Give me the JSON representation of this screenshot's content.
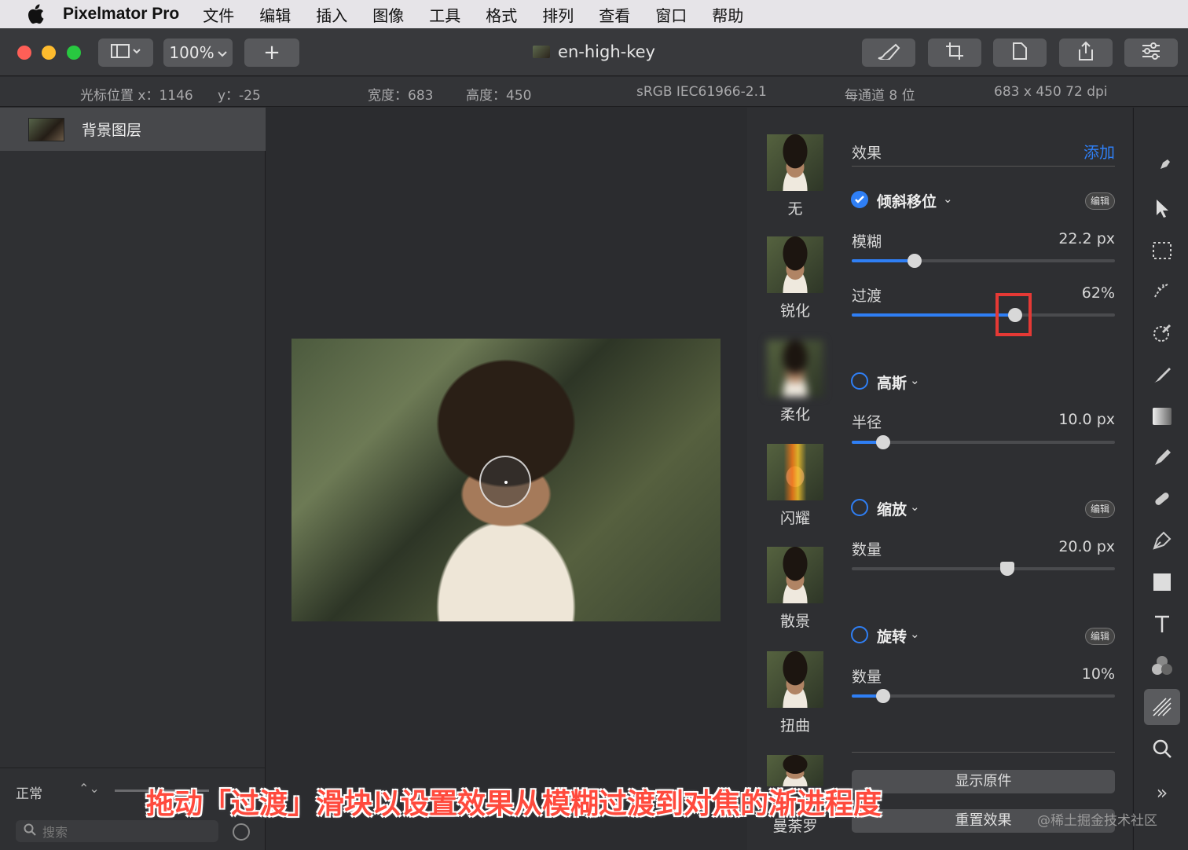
{
  "menubar": {
    "app_name": "Pixelmator Pro",
    "items": [
      "文件",
      "编辑",
      "插入",
      "图像",
      "工具",
      "格式",
      "排列",
      "查看",
      "窗口",
      "帮助"
    ]
  },
  "toolbar": {
    "zoom": "100%",
    "add": "+",
    "document_title": "en-high-key"
  },
  "infobar": {
    "cursor_x": "光标位置 x：1146",
    "cursor_y": "y：-25",
    "width": "宽度：683",
    "height": "高度：450",
    "color_profile": "sRGB IEC61966-2.1",
    "bit_depth": "每通道 8 位",
    "size_dpi": "683 x 450 72 dpi"
  },
  "layers": {
    "layer_name": "背景图层",
    "blend_mode": "正常",
    "search_placeholder": "搜索"
  },
  "effects_list": [
    "无",
    "锐化",
    "柔化",
    "闪耀",
    "散景",
    "扭曲",
    "曼荼罗"
  ],
  "settings": {
    "title": "效果",
    "add": "添加",
    "tilt_shift": {
      "name": "倾斜移位",
      "edit": "编辑",
      "enabled": true
    },
    "blur": {
      "label": "模糊",
      "value": "22.2 px",
      "level": 0.24
    },
    "transition": {
      "label": "过渡",
      "value": "62%",
      "level": 0.62
    },
    "gaussian": {
      "name": "高斯",
      "enabled": false
    },
    "radius": {
      "label": "半径",
      "value": "10.0 px",
      "level": 0.12
    },
    "zoom": {
      "name": "缩放",
      "edit": "编辑",
      "enabled": false
    },
    "zoom_amount": {
      "label": "数量",
      "value": "20.0 px",
      "level": 0.59
    },
    "twirl": {
      "name": "旋转",
      "edit": "编辑",
      "enabled": false
    },
    "twirl_amount": {
      "label": "数量",
      "value": "10%",
      "level": 0.12
    },
    "show_original": "显示原件",
    "reset": "重置效果"
  },
  "caption": "拖动「过渡」滑块以设置效果从模糊过渡到对焦的渐进程度",
  "watermark": "@稀土掘金技术社区",
  "colors": {
    "accent": "#2f7ff5",
    "caption_red": "#ff4a3d",
    "highlight": "#e53935"
  }
}
